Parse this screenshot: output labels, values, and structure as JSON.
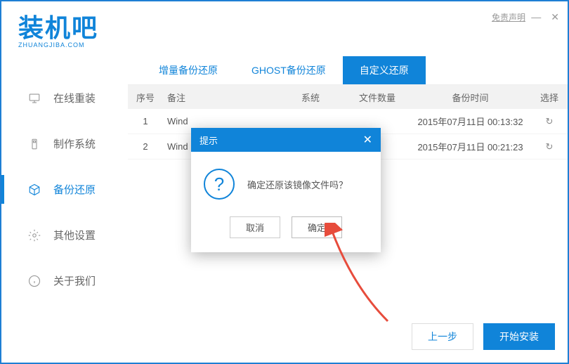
{
  "header": {
    "logo_main": "装机吧",
    "logo_sub": "ZHUANGJIBA.COM",
    "disclaimer": "免责声明"
  },
  "sidebar": {
    "items": [
      {
        "label": "在线重装"
      },
      {
        "label": "制作系统"
      },
      {
        "label": "备份还原"
      },
      {
        "label": "其他设置"
      },
      {
        "label": "关于我们"
      }
    ]
  },
  "tabs": {
    "items": [
      {
        "label": "增量备份还原"
      },
      {
        "label": "GHOST备份还原"
      },
      {
        "label": "自定义还原"
      }
    ]
  },
  "table": {
    "headers": {
      "num": "序号",
      "remark": "备注",
      "sys": "系统",
      "count": "文件数量",
      "time": "备份时间",
      "select": "选择"
    },
    "rows": [
      {
        "num": "1",
        "remark": "Wind",
        "time": "2015年07月11日 00:13:32"
      },
      {
        "num": "2",
        "remark": "Wind",
        "time": "2015年07月11日 00:21:23"
      }
    ]
  },
  "dialog": {
    "title": "提示",
    "message": "确定还原该镜像文件吗？",
    "cancel": "取消",
    "ok": "确定"
  },
  "footer": {
    "prev": "上一步",
    "start": "开始安装"
  }
}
